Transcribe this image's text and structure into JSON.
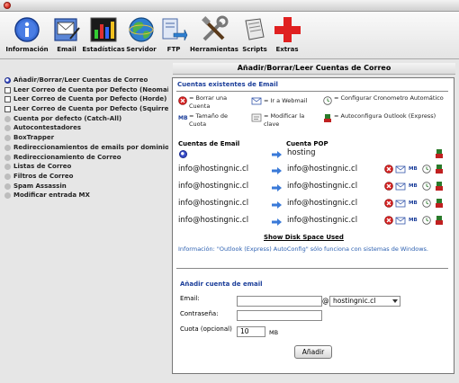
{
  "toolbar": {
    "items": [
      {
        "label": "Información",
        "icon": "info-icon"
      },
      {
        "label": "Email",
        "icon": "email-icon"
      },
      {
        "label": "Estadísticas",
        "icon": "statistics-icon"
      },
      {
        "label": "Servidor",
        "icon": "server-globe-icon"
      },
      {
        "label": "FTP",
        "icon": "ftp-icon"
      },
      {
        "label": "Herramientas",
        "icon": "tools-icon"
      },
      {
        "label": "Scripts",
        "icon": "scripts-icon"
      },
      {
        "label": "Extras",
        "icon": "extras-plus-icon"
      }
    ]
  },
  "sidebar": {
    "items": [
      {
        "label": "Añadir/Borrar/Leer Cuentas de Correo",
        "active": true
      },
      {
        "label": "Leer Correo de Cuenta por Defecto (Neomail)"
      },
      {
        "label": "Leer Correo de Cuenta por Defecto (Horde)"
      },
      {
        "label": "Leer Correo de Cuenta por Defecto (Squirrelmail)"
      },
      {
        "label": "Cuenta por defecto (Catch-All)"
      },
      {
        "label": "Autocontestadores"
      },
      {
        "label": "BoxTrapper"
      },
      {
        "label": "Redireccionamientos de emails por dominio."
      },
      {
        "label": "Redireccionamiento de Correo"
      },
      {
        "label": "Listas de Correo"
      },
      {
        "label": "Filtros de Correo"
      },
      {
        "label": "Spam Assassin"
      },
      {
        "label": "Modificar entrada MX"
      }
    ]
  },
  "page": {
    "heading": "Añadir/Borrar/Leer Cuentas de Correo",
    "existing_title": "Cuentas existentes de Email"
  },
  "legend": {
    "delete": "= Borrar una Cuenta",
    "webmail": "= Ir a Webmail",
    "cron": "= Configurar Cronometro Automático",
    "quota": "= Tamaño de Cuota",
    "password": "= Modificar la clave",
    "outlook": "= Autoconfigura Outlook (Express)",
    "quota_abbr": "MB"
  },
  "accounts": {
    "col_email": "Cuentas de Email",
    "col_pop": "Cuenta POP",
    "default_pop": "hosting",
    "rows": [
      {
        "email": "info@hostingnic.cl",
        "pop": "info@hostingnic.cl"
      },
      {
        "email": "info@hostingnic.cl",
        "pop": "info@hostingnic.cl"
      },
      {
        "email": "info@hostingnic.cl",
        "pop": "info@hostingnic.cl"
      },
      {
        "email": "info@hostingnic.cl",
        "pop": "info@hostingnic.cl"
      }
    ],
    "show_disk": "Show Disk Space Used",
    "info_note": "Información: \"Outlook (Express) AutoConfig\" sólo funciona con sistemas de Windows."
  },
  "add_form": {
    "title": "Añadir cuenta de email",
    "email_label": "Email:",
    "email_value": "",
    "at_sign": "@",
    "domain_selected": "hostingnic.cl",
    "password_label": "Contraseña:",
    "password_value": "",
    "quota_label": "Cuota (opcional)",
    "quota_value": "10",
    "quota_unit": "MB",
    "submit_label": "Añadir"
  }
}
